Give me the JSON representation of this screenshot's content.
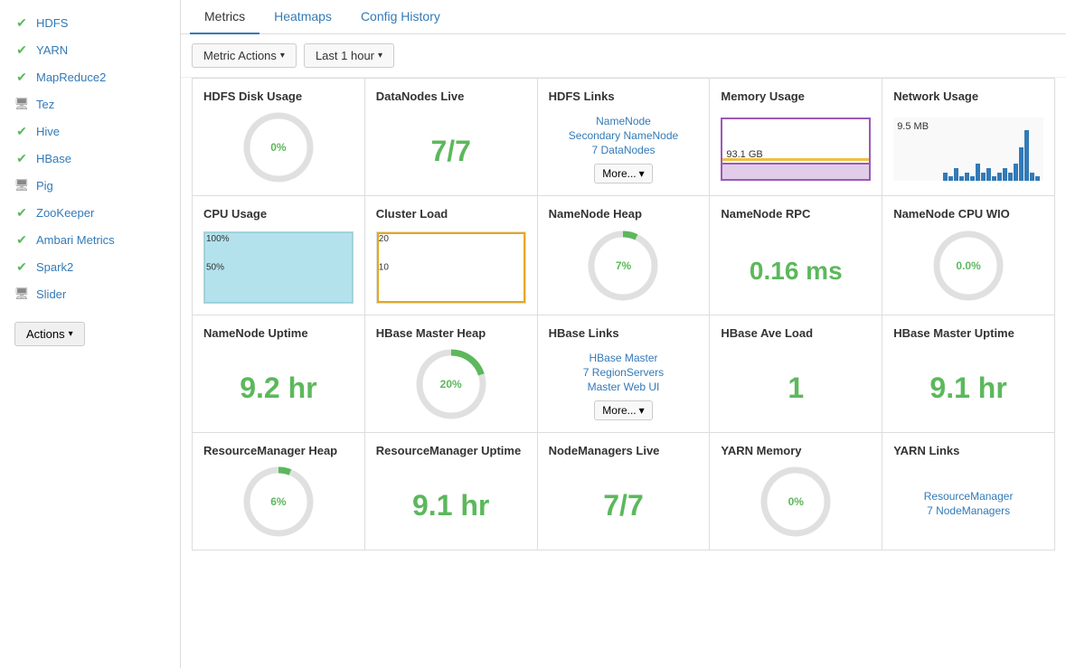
{
  "sidebar": {
    "items": [
      {
        "id": "hdfs",
        "label": "HDFS",
        "icon": "check",
        "type": "check"
      },
      {
        "id": "yarn",
        "label": "YARN",
        "icon": "check",
        "type": "check"
      },
      {
        "id": "mapreduce2",
        "label": "MapReduce2",
        "icon": "check",
        "type": "check"
      },
      {
        "id": "tez",
        "label": "Tez",
        "icon": "monitor",
        "type": "monitor"
      },
      {
        "id": "hive",
        "label": "Hive",
        "icon": "check",
        "type": "check"
      },
      {
        "id": "hbase",
        "label": "HBase",
        "icon": "check",
        "type": "check"
      },
      {
        "id": "pig",
        "label": "Pig",
        "icon": "monitor",
        "type": "monitor"
      },
      {
        "id": "zookeeper",
        "label": "ZooKeeper",
        "icon": "check",
        "type": "check"
      },
      {
        "id": "ambari-metrics",
        "label": "Ambari Metrics",
        "icon": "check",
        "type": "check"
      },
      {
        "id": "spark2",
        "label": "Spark2",
        "icon": "check",
        "type": "check"
      },
      {
        "id": "slider",
        "label": "Slider",
        "icon": "monitor",
        "type": "monitor"
      }
    ],
    "actions_label": "Actions"
  },
  "tabs": [
    {
      "id": "metrics",
      "label": "Metrics",
      "active": true
    },
    {
      "id": "heatmaps",
      "label": "Heatmaps",
      "active": false
    },
    {
      "id": "config-history",
      "label": "Config History",
      "active": false
    }
  ],
  "toolbar": {
    "metric_actions_label": "Metric Actions",
    "last_hour_label": "Last 1 hour"
  },
  "metrics": {
    "row1": [
      {
        "id": "hdfs-disk-usage",
        "title": "HDFS Disk Usage",
        "type": "gauge",
        "value": "0%",
        "percent": 0
      },
      {
        "id": "datanodes-live",
        "title": "DataNodes Live",
        "type": "large-value",
        "value": "7/7"
      },
      {
        "id": "hdfs-links",
        "title": "HDFS Links",
        "type": "links",
        "links": [
          "NameNode",
          "Secondary NameNode",
          "7 DataNodes"
        ],
        "more": true
      },
      {
        "id": "memory-usage",
        "title": "Memory Usage",
        "type": "memory-chart",
        "value": "93.1 GB"
      },
      {
        "id": "network-usage",
        "title": "Network Usage",
        "type": "network-chart",
        "value": "9.5 MB"
      }
    ],
    "row2": [
      {
        "id": "cpu-usage",
        "title": "CPU Usage",
        "type": "cpu-chart",
        "label100": "100%",
        "label50": "50%"
      },
      {
        "id": "cluster-load",
        "title": "Cluster Load",
        "type": "cluster-chart",
        "label20": "20",
        "label10": "10"
      },
      {
        "id": "namenode-heap",
        "title": "NameNode Heap",
        "type": "gauge",
        "value": "7%",
        "percent": 7
      },
      {
        "id": "namenode-rpc",
        "title": "NameNode RPC",
        "type": "rpc",
        "value": "0.16 ms"
      },
      {
        "id": "namenode-cpu-wio",
        "title": "NameNode CPU WIO",
        "type": "gauge",
        "value": "0.0%",
        "percent": 0
      }
    ],
    "row3": [
      {
        "id": "namenode-uptime",
        "title": "NameNode Uptime",
        "type": "large-value",
        "value": "9.2 hr"
      },
      {
        "id": "hbase-master-heap",
        "title": "HBase Master Heap",
        "type": "gauge",
        "value": "20%",
        "percent": 20
      },
      {
        "id": "hbase-links",
        "title": "HBase Links",
        "type": "links",
        "links": [
          "HBase Master",
          "7 RegionServers",
          "Master Web UI"
        ],
        "more": true
      },
      {
        "id": "hbase-ave-load",
        "title": "HBase Ave Load",
        "type": "large-value",
        "value": "1"
      },
      {
        "id": "hbase-master-uptime",
        "title": "HBase Master Uptime",
        "type": "large-value",
        "value": "9.1 hr"
      }
    ],
    "row4": [
      {
        "id": "resourcemanager-heap",
        "title": "ResourceManager Heap",
        "type": "gauge",
        "value": "6%",
        "percent": 6
      },
      {
        "id": "resourcemanager-uptime",
        "title": "ResourceManager Uptime",
        "type": "large-value",
        "value": "9.1 hr"
      },
      {
        "id": "nodemanagers-live",
        "title": "NodeManagers Live",
        "type": "large-value",
        "value": "7/7"
      },
      {
        "id": "yarn-memory",
        "title": "YARN Memory",
        "type": "gauge",
        "value": "0%",
        "percent": 0
      },
      {
        "id": "yarn-links",
        "title": "YARN Links",
        "type": "links",
        "links": [
          "ResourceManager",
          "7 NodeManagers"
        ],
        "more": false
      }
    ]
  }
}
